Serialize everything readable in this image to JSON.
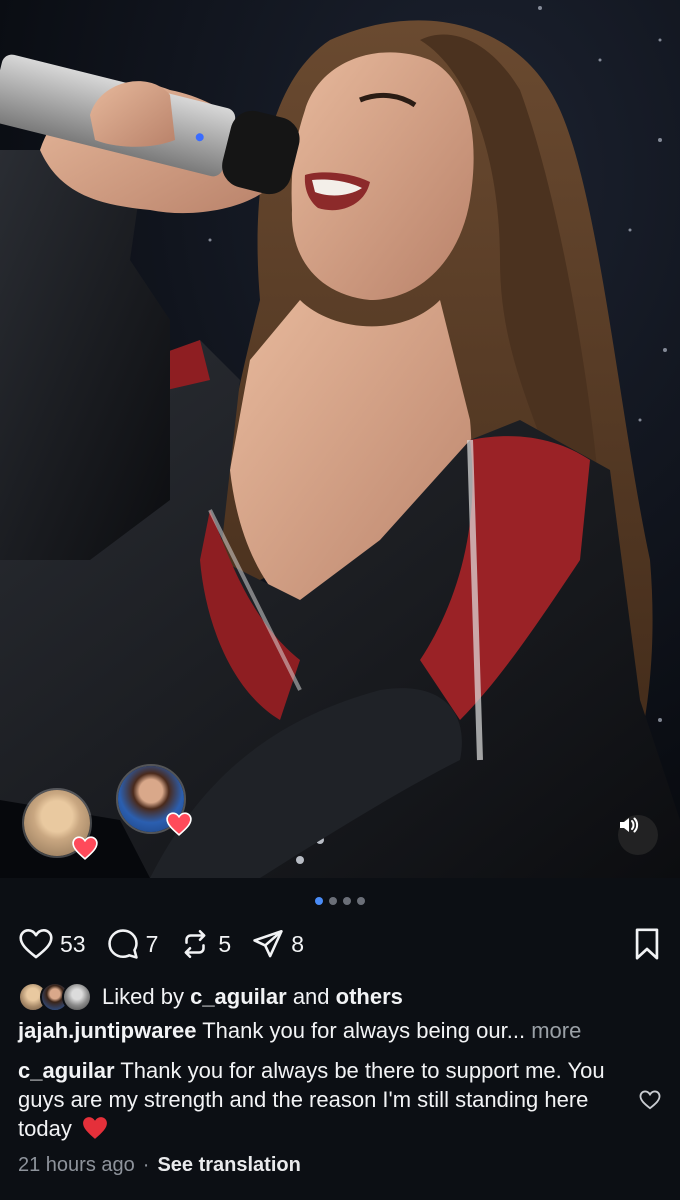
{
  "post": {
    "image_alt": "singer-performing-photo",
    "carousel": {
      "count": 4,
      "active": 0
    }
  },
  "reactors": [
    {
      "name": "reactor-1",
      "reaction": "heart"
    },
    {
      "name": "reactor-2",
      "reaction": "heart"
    }
  ],
  "actions": {
    "likes": "53",
    "comments": "7",
    "reposts": "5",
    "shares": "8"
  },
  "liked_by": {
    "prefix": "Liked by",
    "user": "c_aguilar",
    "and": "and",
    "others": "others"
  },
  "captions": [
    {
      "user": "jajah.juntipwaree",
      "text": "Thank you for always being our...",
      "more": "more"
    },
    {
      "user": "c_aguilar",
      "text": "Thank you for always be there to support me. You guys are my strength and the reason I'm still standing here today",
      "emoji": "heart-emoji"
    }
  ],
  "meta": {
    "time": "21 hours ago",
    "separator": "·",
    "translate": "See translation"
  },
  "colors": {
    "accent": "#4a8cf7",
    "background": "#0c0f14",
    "heart": "#e5303a"
  }
}
